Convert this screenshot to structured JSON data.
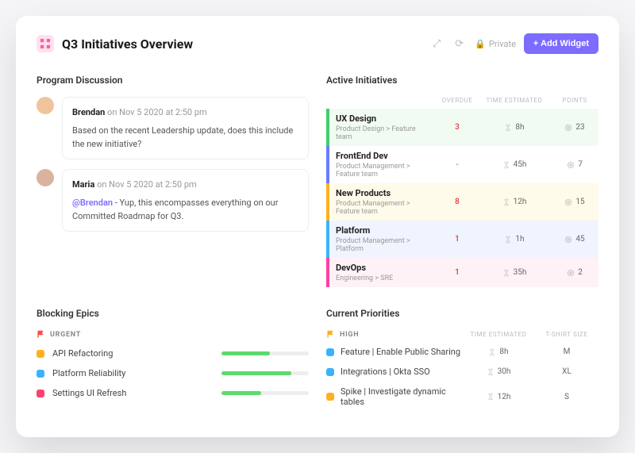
{
  "header": {
    "title": "Q3 Initiatives Overview",
    "private": "Private",
    "add": "+ Add Widget"
  },
  "discussion": {
    "title": "Program Discussion",
    "comments": [
      {
        "author": "Brendan",
        "ts": "on Nov 5 2020 at 2:50 pm",
        "body": "Based on the recent Leadership update, does this include the new initiative?",
        "avatar": "#f0c49a"
      },
      {
        "author": "Maria",
        "ts": "on Nov 5 2020 at 2:50 pm",
        "mention": "@Brendan",
        "body": " - Yup, this encompasses everything on our Committed Roadmap for Q3.",
        "avatar": "#d9b3a0"
      }
    ]
  },
  "initiatives": {
    "title": "Active Initiatives",
    "cols": {
      "overdue": "OVERDUE",
      "time": "TIME ESTIMATED",
      "points": "POINTS"
    },
    "rows": [
      {
        "name": "UX Design",
        "crumb": "Product Design > Feature team",
        "overdue": "3",
        "time": "8h",
        "points": "23",
        "bar": "#3fcf6b",
        "bg": "bg-green"
      },
      {
        "name": "FrontEnd Dev",
        "crumb": "Product Management > Feature team",
        "overdue": "-",
        "time": "45h",
        "points": "7",
        "bar": "#6a7cff",
        "bg": "bg-plain"
      },
      {
        "name": "New Products",
        "crumb": "Product Management > Feature team",
        "overdue": "8",
        "time": "12h",
        "points": "15",
        "bar": "#ffb020",
        "bg": "bg-yellow"
      },
      {
        "name": "Platform",
        "crumb": "Product Management > Platform",
        "overdue": "1",
        "time": "1h",
        "points": "45",
        "bar": "#39b3ff",
        "bg": "bg-blue"
      },
      {
        "name": "DevOps",
        "crumb": "Engineering > SRE",
        "overdue": "1",
        "time": "35h",
        "points": "2",
        "bar": "#ff3fa4",
        "bg": "bg-pink"
      }
    ]
  },
  "epics": {
    "title": "Blocking Epics",
    "flag": "URGENT",
    "rows": [
      {
        "name": "API Refactoring",
        "color": "#ffb020",
        "pct": 55
      },
      {
        "name": "Platform Reliability",
        "color": "#39b3ff",
        "pct": 80
      },
      {
        "name": "Settings UI Refresh",
        "color": "#ff3f6e",
        "pct": 45
      }
    ]
  },
  "priorities": {
    "title": "Current Priorities",
    "flag": "HIGH",
    "cols": {
      "time": "TIME ESTIMATED",
      "size": "T-SHIRT SIZE"
    },
    "rows": [
      {
        "name": "Feature | Enable Public Sharing",
        "color": "#39b3ff",
        "time": "8h",
        "size": "M"
      },
      {
        "name": "Integrations | Okta SSO",
        "color": "#39b3ff",
        "time": "30h",
        "size": "XL"
      },
      {
        "name": "Spike | Investigate dynamic tables",
        "color": "#ffb020",
        "time": "12h",
        "size": "S"
      }
    ]
  }
}
